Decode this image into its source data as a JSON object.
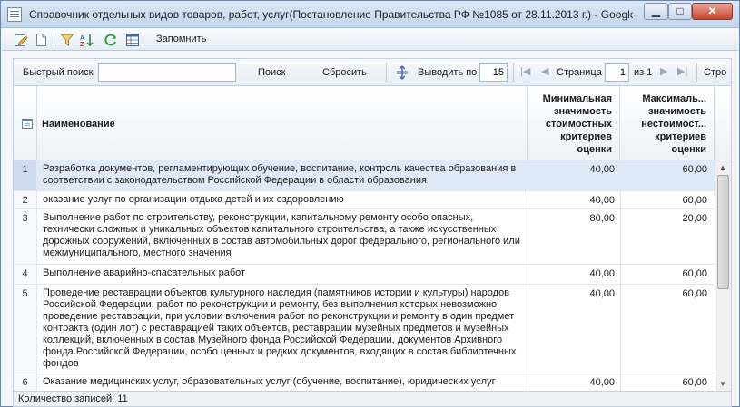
{
  "window": {
    "title": "Справочник отдельных видов товаров, работ, услуг(Постановление Правительства РФ №1085 от 28.11.2013 г.) - Google...",
    "minimize_icon": "minimize-icon",
    "maximize_icon": "maximize-icon",
    "close_icon": "close-icon"
  },
  "toolbar": {
    "icons": [
      "edit-icon",
      "new-document-icon",
      "filter-icon",
      "sort-icon",
      "refresh-icon",
      "export-icon"
    ],
    "remember_label": "Запомнить"
  },
  "search": {
    "quick_search_label": "Быстрый поиск",
    "quick_search_value": "",
    "search_button": "Поиск",
    "reset_button": "Сбросить",
    "output_per_label": "Выводить по",
    "output_per_value": "15",
    "page_label": "Страница",
    "page_value": "1",
    "of_label": "из 1",
    "rows_label_cut": "Стро"
  },
  "grid": {
    "columns": {
      "name": "Наименование",
      "min": "Минимальная\nзначимость\nстоимостных\nкритериев\nоценки",
      "max": "Максималь...\nзначимость\nнестоимост...\nкритериев\nоценки"
    },
    "rows": [
      {
        "num": "1",
        "name": "Разработка документов, регламентирующих обучение, воспитание, контроль качества образования в соответствии с законодательством Российской Федерации в области образования",
        "min": "40,00",
        "max": "60,00"
      },
      {
        "num": "2",
        "name": "оказание услуг по организации отдыха детей и их оздоровлению",
        "min": "40,00",
        "max": "60,00"
      },
      {
        "num": "3",
        "name": "Выполнение работ по строительству, реконструкции, капитальному ремонту особо опасных, технически сложных и уникальных объектов капитального строительства, а также искусственных дорожных сооружений, включенных в состав автомобильных дорог федерального, регионального или межмуниципального, местного значения",
        "min": "80,00",
        "max": "20,00"
      },
      {
        "num": "4",
        "name": "Выполнение аварийно-спасательных работ",
        "min": "40,00",
        "max": "60,00"
      },
      {
        "num": "5",
        "name": "Проведение реставрации объектов культурного наследия (памятников истории и культуры) народов Российской Федерации, работ по реконструкции и ремонту, без выполнения которых невозможно проведение реставрации, при условии включения работ по реконструкции и ремонту в один предмет контракта (один лот) с реставрацией таких объектов, реставрации музейных предметов и музейных коллекций, включенных в состав Музейного фонда Российской Федерации, документов Архивного фонда Российской Федерации, особо ценных и редких документов, входящих в состав библиотечных фондов",
        "min": "40,00",
        "max": "60,00"
      },
      {
        "num": "6",
        "name": "Оказание медицинских услуг, образовательных услуг (обучение, воспитание), юридических услуг",
        "min": "40,00",
        "max": "60,00"
      }
    ]
  },
  "status": {
    "records_label": "Количество записей: 11"
  }
}
